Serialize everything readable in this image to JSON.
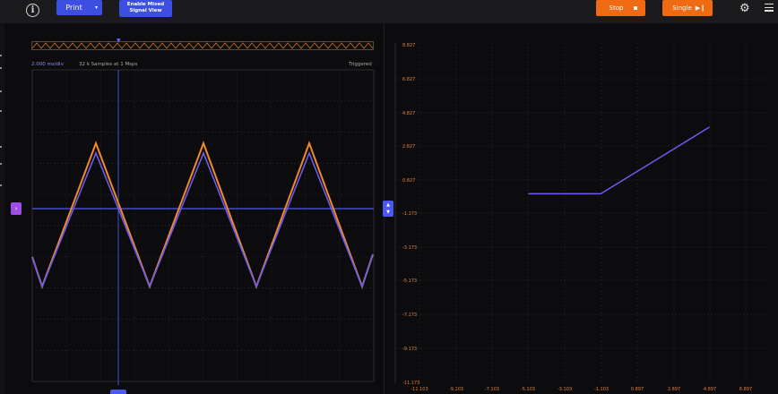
{
  "toolbar": {
    "info_label": "i",
    "print_label": "Print",
    "print_caret": "▾",
    "mixed_line1": "Enable Mixed",
    "mixed_line2": "Signal View",
    "stop_label": "Stop",
    "single_label": "Single",
    "single_icon": "▶❙",
    "gear_glyph": "⚙"
  },
  "scope": {
    "timebase": "2.000 ms/div",
    "samples": "32 k Samples at 1 Msps",
    "trigger_status": "Triggered",
    "channel_marker": "›",
    "trigger_marker_up": "▲",
    "trigger_marker_down": "▼"
  },
  "colors": {
    "accent_blue": "#3d4fe0",
    "trace_orange": "#f08a2c",
    "trace_purple": "#6a5cf0",
    "button_orange": "#f06a12",
    "channel_marker": "#9c4de6"
  },
  "xy_plot": {
    "y_ticks": [
      "8.827",
      "6.827",
      "4.827",
      "2.827",
      "0.827",
      "-1.173",
      "-3.173",
      "-5.173",
      "-7.173",
      "-9.173",
      "-11.173"
    ],
    "x_ticks": [
      "-11.103",
      "-9.103",
      "-7.103",
      "-5.103",
      "-3.103",
      "-1.103",
      "0.897",
      "2.897",
      "4.897",
      "6.897"
    ]
  },
  "chart_data": {
    "type": "line",
    "ylim": [
      -11.173,
      8.827
    ],
    "xlim": [
      -12.1,
      7.9
    ],
    "series": [
      {
        "x": [
          -5.103,
          -1.103,
          4.897
        ],
        "y": [
          0.0,
          0.0,
          3.95
        ]
      }
    ]
  }
}
